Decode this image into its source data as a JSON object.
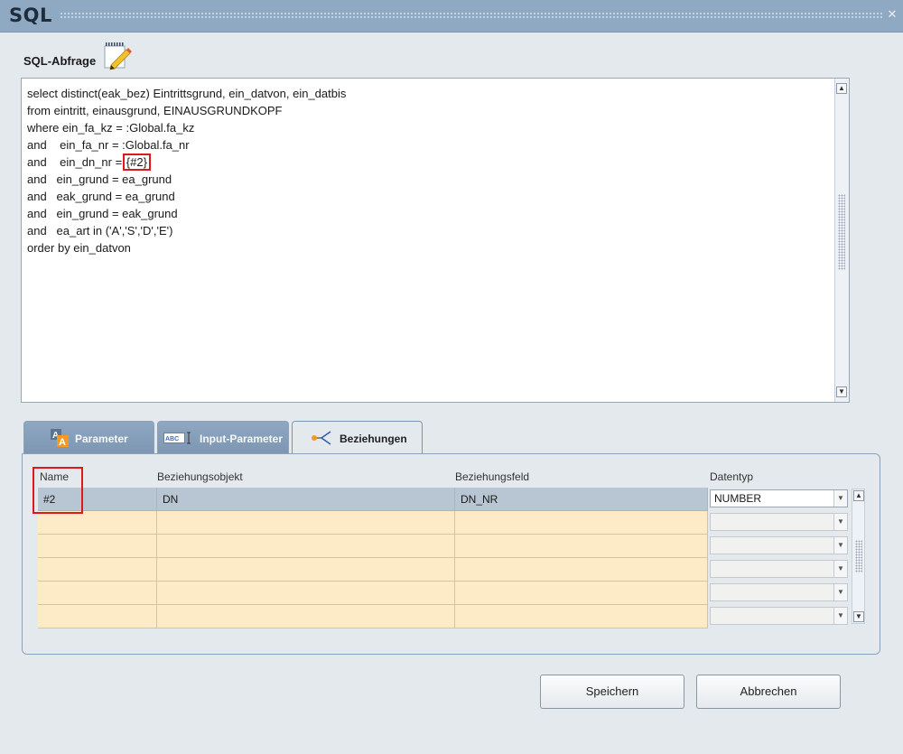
{
  "window": {
    "title": "SQL"
  },
  "sql": {
    "label": "SQL-Abfrage",
    "lines": [
      "select distinct(eak_bez) Eintrittsgrund, ein_datvon, ein_datbis",
      "from eintritt, einausgrund, EINAUSGRUNDKOPF",
      "where ein_fa_kz = :Global.fa_kz",
      "and    ein_fa_nr = :Global.fa_nr",
      "and    ein_dn_nr = ",
      "and   ein_grund = ea_grund",
      "and   eak_grund = ea_grund",
      "and   ein_grund = eak_grund",
      "and   ea_art in ('A','S','D','E')",
      "order by ein_datvon"
    ],
    "highlight": "{#2}"
  },
  "tabs": [
    {
      "label": "Parameter",
      "icon": "text-format-icon"
    },
    {
      "label": "Input-Parameter",
      "icon": "text-input-icon"
    },
    {
      "label": "Beziehungen",
      "icon": "relations-icon"
    }
  ],
  "table": {
    "headers": [
      "Name",
      "Beziehungsobjekt",
      "Beziehungsfeld",
      "Datentyp"
    ],
    "rows": [
      {
        "name": "#2",
        "objekt": "DN",
        "feld": "DN_NR",
        "datentyp": "NUMBER"
      },
      {
        "name": "",
        "objekt": "",
        "feld": "",
        "datentyp": ""
      },
      {
        "name": "",
        "objekt": "",
        "feld": "",
        "datentyp": ""
      },
      {
        "name": "",
        "objekt": "",
        "feld": "",
        "datentyp": ""
      },
      {
        "name": "",
        "objekt": "",
        "feld": "",
        "datentyp": ""
      },
      {
        "name": "",
        "objekt": "",
        "feld": "",
        "datentyp": ""
      }
    ]
  },
  "buttons": {
    "save": "Speichern",
    "cancel": "Abbrechen"
  },
  "colors": {
    "highlight_box": "#e0171b",
    "empty_row": "#fdebc8",
    "selected_row": "#b8c5d2",
    "titlebar": "#90a9c3"
  }
}
